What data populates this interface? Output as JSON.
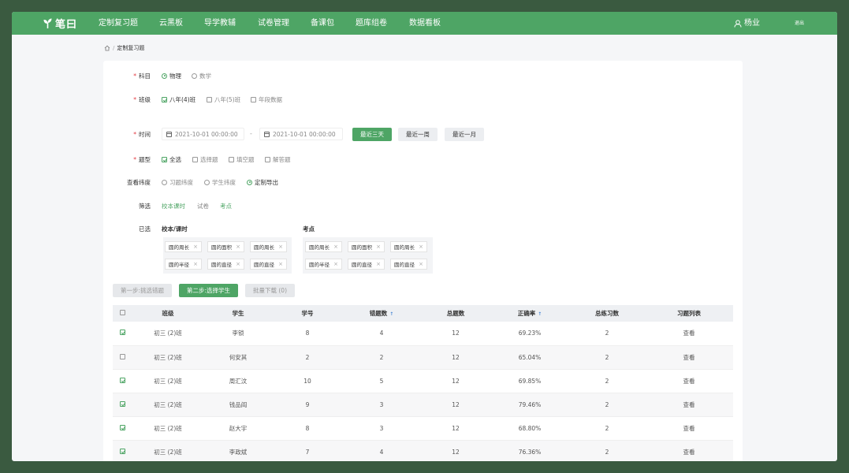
{
  "nav": {
    "logo": "笔曰",
    "items": [
      "定制复习题",
      "云黑板",
      "导学教辅",
      "试卷管理",
      "备课包",
      "题库组卷",
      "数据看板"
    ],
    "user": "杨业",
    "logout": "退出"
  },
  "breadcrumb": {
    "separator": "/",
    "current": "定制复习题"
  },
  "filters": {
    "subject": {
      "label": "科目",
      "options": [
        "物理",
        "数学"
      ],
      "selected": "物理"
    },
    "class": {
      "label": "班级",
      "options": [
        "八年(4)班",
        "八年(5)班",
        "年段数据"
      ],
      "checked": [
        "八年(4)班"
      ]
    },
    "time": {
      "label": "时间",
      "start": "2021-10-01  00:00:00",
      "end": "2021-10-01  00:00:00",
      "separator": "-",
      "quick": [
        "最近三天",
        "最近一周",
        "最近一月"
      ],
      "active_quick": "最近三天"
    },
    "qtype": {
      "label": "题型",
      "options": [
        "全选",
        "选择题",
        "填空题",
        "解答题"
      ],
      "checked": [
        "全选"
      ]
    },
    "dimension": {
      "label": "查看纬度",
      "options": [
        "习题纬度",
        "学生纬度",
        "定制导出"
      ],
      "selected": "定制导出"
    },
    "screen": {
      "label": "筛选",
      "options": [
        "校本课时",
        "试卷",
        "考点"
      ]
    },
    "selected": {
      "label": "已选",
      "groups": [
        {
          "title": "校本/课时",
          "tags": [
            "圆的周长",
            "圆的面积",
            "圆的周长",
            "圆的半径",
            "圆的直径",
            "圆的直径"
          ]
        },
        {
          "title": "考点",
          "tags": [
            "圆的周长",
            "圆的面积",
            "圆的周长",
            "圆的半径",
            "圆的直径",
            "圆的直径"
          ]
        }
      ]
    }
  },
  "steps": {
    "step1": "第一步:挑选错题",
    "step2": "第二步:选择学生",
    "download": "批量下载 (0)"
  },
  "table": {
    "headers": [
      "班级",
      "学生",
      "学号",
      "错题数",
      "总题数",
      "正确率",
      "总练习数",
      "习题列表"
    ],
    "sortable": [
      "错题数",
      "正确率"
    ],
    "rows": [
      {
        "checked": true,
        "class": "初三 (2)班",
        "student": "李锁",
        "no": "8",
        "wrong": "4",
        "total": "12",
        "rate": "69.23%",
        "practice": "2",
        "action": "查看"
      },
      {
        "checked": false,
        "class": "初三 (2)班",
        "student": "何安其",
        "no": "2",
        "wrong": "2",
        "total": "12",
        "rate": "65.04%",
        "practice": "2",
        "action": "查看"
      },
      {
        "checked": true,
        "class": "初三 (2)班",
        "student": "周汇汶",
        "no": "10",
        "wrong": "5",
        "total": "12",
        "rate": "69.85%",
        "practice": "2",
        "action": "查看"
      },
      {
        "checked": true,
        "class": "初三 (2)班",
        "student": "钱品阎",
        "no": "9",
        "wrong": "3",
        "total": "12",
        "rate": "79.46%",
        "practice": "2",
        "action": "查看"
      },
      {
        "checked": true,
        "class": "初三 (2)班",
        "student": "赵大宇",
        "no": "8",
        "wrong": "3",
        "total": "12",
        "rate": "68.80%",
        "practice": "2",
        "action": "查看"
      },
      {
        "checked": true,
        "class": "初三 (2)班",
        "student": "李政斌",
        "no": "7",
        "wrong": "4",
        "total": "12",
        "rate": "76.36%",
        "practice": "2",
        "action": "查看"
      }
    ]
  },
  "colors": {
    "brand": "#4ea565",
    "required": "#e2383f",
    "sort": "#4e8ad6"
  }
}
